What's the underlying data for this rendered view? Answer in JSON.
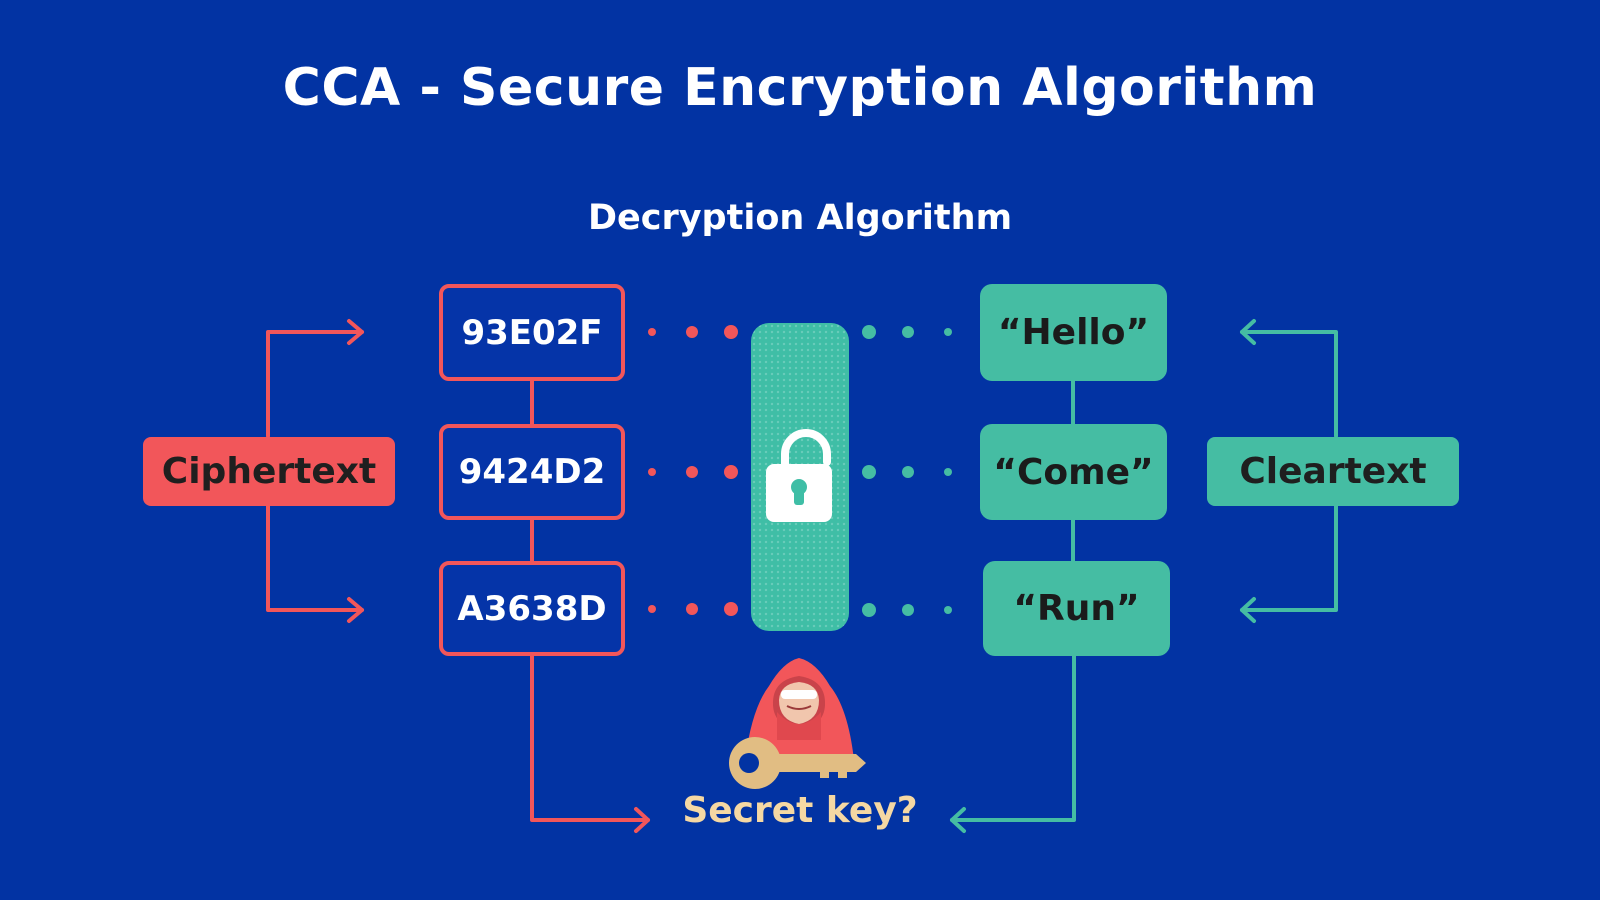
{
  "title": "CCA - Secure Encryption Algorithm",
  "subtitle": "Decryption Algorithm",
  "ciphertext_label": "Ciphertext",
  "cleartext_label": "Cleartext",
  "ciphertexts": [
    "93E02F",
    "9424D2",
    "A3638D"
  ],
  "cleartexts": [
    "“Hello”",
    "“Come”",
    "“Run”"
  ],
  "secret_key_label": "Secret key?",
  "icons": {
    "lock": "unlocked-padlock-icon",
    "attacker": "hooded-hacker-icon",
    "key": "key-icon"
  },
  "colors": {
    "background": "#0233a3",
    "cipher_accent": "#f2565a",
    "clear_accent": "#45bda3",
    "secret_text": "#f5d8a3"
  }
}
